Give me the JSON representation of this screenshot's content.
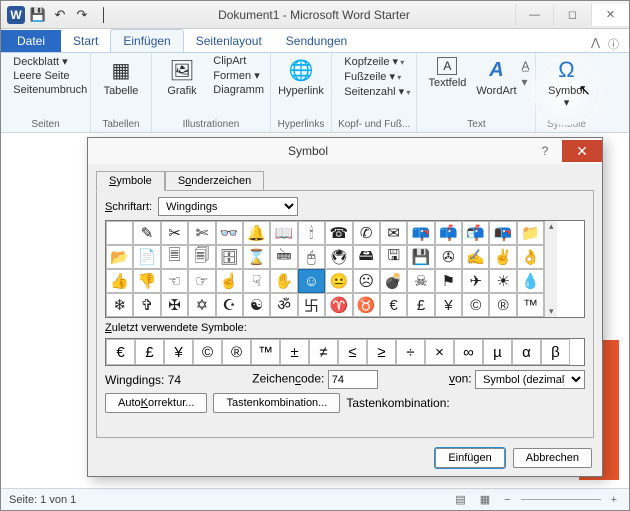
{
  "title": "Dokument1 - Microsoft Word Starter",
  "qat": [
    "💾",
    "↶",
    "↷",
    "│"
  ],
  "winctrls": [
    "—",
    "◻",
    "✕"
  ],
  "tabs": {
    "file": "Datei",
    "items": [
      "Start",
      "Einfügen",
      "Seitenlayout",
      "Sendungen"
    ],
    "active": 1,
    "mini": [
      "⋀",
      "ⓘ"
    ]
  },
  "ribbon": {
    "seiten": {
      "label": "Seiten",
      "items": [
        "Deckblatt ▾",
        "Leere Seite",
        "Seitenumbruch"
      ]
    },
    "tabellen": {
      "label": "Tabellen",
      "btn": "Tabelle"
    },
    "illustrationen": {
      "label": "Illustrationen",
      "grafik": "Grafik",
      "items": [
        "ClipArt",
        "Formen ▾",
        "Diagramm"
      ]
    },
    "hyperlinks": {
      "label": "Hyperlinks",
      "btn": "Hyperlink"
    },
    "kopf": {
      "label": "Kopf- und Fuß...",
      "items": [
        "Kopfzeile ▾",
        "Fußzeile ▾",
        "Seitenzahl ▾"
      ]
    },
    "text": {
      "label": "Text",
      "textfeld": "Textfeld",
      "wordart": "WordArt"
    },
    "symbole": {
      "label": "Symbole",
      "btn": "Symbol ▾"
    }
  },
  "dialog": {
    "title": "Symbol",
    "tabs": [
      "Symbole",
      "Sonderzeichen"
    ],
    "schriftart_label": "Schriftart:",
    "schriftart_value": "Wingdings",
    "symbols": [
      "",
      "✎",
      "✂",
      "✄",
      "👓",
      "🔔",
      "📖",
      "🕯",
      "☎",
      "✆",
      "✉",
      "📪",
      "📫",
      "📬",
      "📭",
      "📁",
      "📂",
      "📄",
      "🗏",
      "🗐",
      "🗄",
      "⌛",
      "🖮",
      "🖰",
      "🖲",
      "🖴",
      "🖫",
      "💾",
      "✇",
      "✍",
      "✌",
      "👌",
      "👍",
      "👎",
      "☜",
      "☞",
      "☝",
      "☟",
      "✋",
      "☺",
      "😐",
      "☹",
      "💣",
      "☠",
      "⚑",
      "✈",
      "☀",
      "💧",
      "❄",
      "✞",
      "✠",
      "✡",
      "☪",
      "☯",
      "ॐ",
      "卐",
      "♈",
      "♉",
      "€",
      "£",
      "¥",
      "©",
      "®",
      "™"
    ],
    "selected_index": 39,
    "zuletzt_label": "Zuletzt verwendete Symbole:",
    "recent": [
      "€",
      "£",
      "¥",
      "©",
      "®",
      "™",
      "±",
      "≠",
      "≤",
      "≥",
      "÷",
      "×",
      "∞",
      "µ",
      "α",
      "β"
    ],
    "name": "Wingdings: 74",
    "code_label": "Zeichencode:",
    "code_value": "74",
    "from_label": "von:",
    "from_value": "Symbol (dezimal)",
    "autokorrektur": "AutoKorrektur...",
    "tastenkomb": "Tastenkombination...",
    "tastenkomb_label": "Tastenkombination:",
    "insert": "Einfügen",
    "cancel": "Abbrechen"
  },
  "status": {
    "page": "Seite: 1 von 1"
  }
}
